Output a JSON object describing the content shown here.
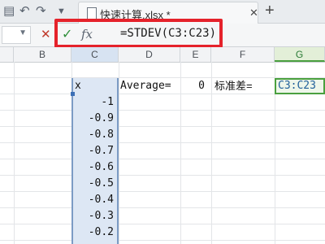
{
  "titlebar": {
    "tab_name": "快速计算.xlsx *",
    "close_glyph": "✕",
    "new_tab_glyph": "+"
  },
  "formula_bar": {
    "cancel_glyph": "✕",
    "confirm_glyph": "✓",
    "fx_label": "fx",
    "formula_text": "=STDEV(C3:C23)"
  },
  "columns": [
    "B",
    "C",
    "D",
    "E",
    "F",
    "G"
  ],
  "sheet": {
    "header_row": {
      "c": "x",
      "d": "Average=",
      "e": "0",
      "f": "标准差=",
      "g": "C3:C23"
    },
    "c_values": [
      "-1",
      "-0.9",
      "-0.8",
      "-0.7",
      "-0.6",
      "-0.5",
      "-0.4",
      "-0.3",
      "-0.2"
    ]
  },
  "colors": {
    "highlight_box": "#e5222b",
    "selection_fill": "#dde7f4",
    "active_cell_border": "#4aa03f"
  }
}
